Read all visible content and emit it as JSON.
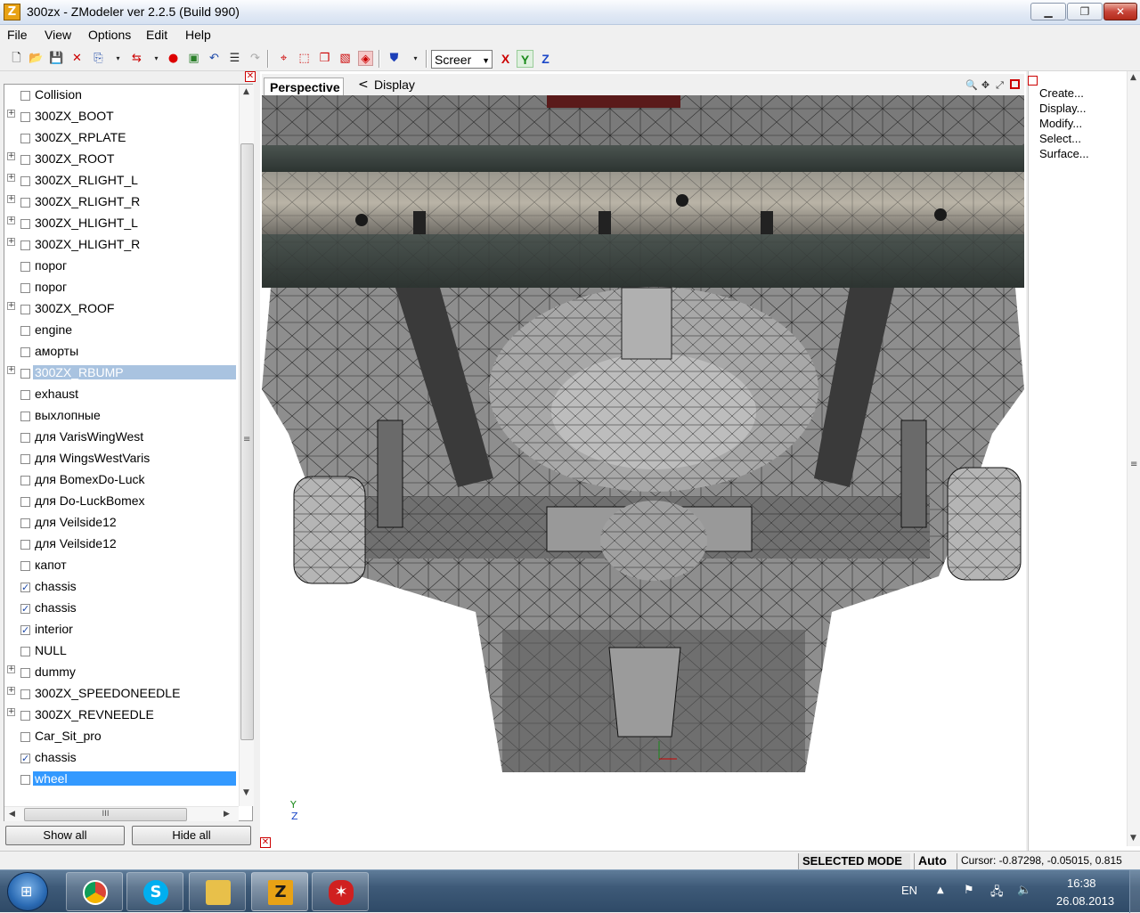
{
  "window": {
    "title": "300zx - ZModeler ver 2.2.5 (Build 990)",
    "min": "▁",
    "max": "❐",
    "close": "✕"
  },
  "menu": [
    "File",
    "View",
    "Options",
    "Edit",
    "Help"
  ],
  "toolbar": {
    "screen_value": "Screer",
    "axis_x": "X",
    "axis_y": "Y",
    "axis_z": "Z"
  },
  "tree": {
    "items": [
      {
        "label": "Collision",
        "expand": false,
        "checked": false
      },
      {
        "label": "300ZX_BOOT",
        "expand": true,
        "checked": false
      },
      {
        "label": "300ZX_RPLATE",
        "expand": false,
        "checked": false
      },
      {
        "label": "300ZX_ROOT",
        "expand": true,
        "checked": false
      },
      {
        "label": "300ZX_RLIGHT_L",
        "expand": true,
        "checked": false
      },
      {
        "label": "300ZX_RLIGHT_R",
        "expand": true,
        "checked": false
      },
      {
        "label": "300ZX_HLIGHT_L",
        "expand": true,
        "checked": false
      },
      {
        "label": "300ZX_HLIGHT_R",
        "expand": true,
        "checked": false
      },
      {
        "label": "порог",
        "expand": false,
        "checked": false
      },
      {
        "label": "порог",
        "expand": false,
        "checked": false
      },
      {
        "label": "300ZX_ROOF",
        "expand": true,
        "checked": false
      },
      {
        "label": "engine",
        "expand": false,
        "checked": false
      },
      {
        "label": "аморты",
        "expand": false,
        "checked": false
      },
      {
        "label": "300ZX_RBUMP",
        "expand": true,
        "checked": false,
        "state": "sel-gray"
      },
      {
        "label": "exhaust",
        "expand": false,
        "checked": false
      },
      {
        "label": "выхлопные",
        "expand": false,
        "checked": false
      },
      {
        "label": "для VarisWingWest",
        "expand": false,
        "checked": false
      },
      {
        "label": "для WingsWestVaris",
        "expand": false,
        "checked": false
      },
      {
        "label": "для BomexDo-Luck",
        "expand": false,
        "checked": false
      },
      {
        "label": "для Do-LuckBomex",
        "expand": false,
        "checked": false
      },
      {
        "label": "для Veilside12",
        "expand": false,
        "checked": false
      },
      {
        "label": "для Veilside12",
        "expand": false,
        "checked": false
      },
      {
        "label": "капот",
        "expand": false,
        "checked": false
      },
      {
        "label": "chassis",
        "expand": false,
        "checked": true
      },
      {
        "label": "chassis",
        "expand": false,
        "checked": true
      },
      {
        "label": "interior",
        "expand": false,
        "checked": true
      },
      {
        "label": "NULL",
        "expand": false,
        "checked": false
      },
      {
        "label": "dummy",
        "expand": true,
        "checked": false
      },
      {
        "label": "300ZX_SPEEDONEEDLE",
        "expand": true,
        "checked": false
      },
      {
        "label": "300ZX_REVNEEDLE",
        "expand": true,
        "checked": false
      },
      {
        "label": "Car_Sit_pro",
        "expand": false,
        "checked": false
      },
      {
        "label": "chassis",
        "expand": false,
        "checked": true
      },
      {
        "label": "wheel",
        "expand": false,
        "checked": false,
        "state": "sel-blue"
      }
    ],
    "hscroll_grip": "III",
    "vscroll_grip": "≡"
  },
  "buttons": {
    "show_all": "Show all",
    "hide_all": "Hide all"
  },
  "viewport": {
    "tab": "Perspective",
    "back": "<",
    "display": "Display",
    "axis_y": "Y",
    "axis_z": "Z"
  },
  "side_menu": [
    "Create...",
    "Display...",
    "Modify...",
    "Select...",
    "Surface..."
  ],
  "status": {
    "mode": "SELECTED MODE",
    "auto": "Auto",
    "cursor": "Cursor: -0.87298, -0.05015, 0.815"
  },
  "taskbar": {
    "lang": "EN",
    "time": "16:38",
    "date": "26.08.2013"
  },
  "colors": {
    "selection_blue": "#3399ff",
    "selection_gray": "#a9c3e0",
    "close_red": "#cc0000"
  }
}
